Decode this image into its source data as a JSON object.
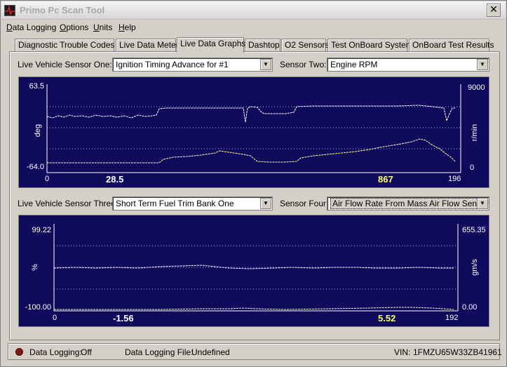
{
  "window": {
    "title": "Primo Pc  Scan Tool",
    "close_glyph": "✕"
  },
  "menu": [
    {
      "accel": "D",
      "rest": "ata Logging"
    },
    {
      "accel": "O",
      "rest": "ptions"
    },
    {
      "accel": "U",
      "rest": "nits"
    },
    {
      "accel": "H",
      "rest": "elp"
    }
  ],
  "tabs": [
    "Diagnostic Trouble Codes",
    "Live Data Meter",
    "Live Data Graphs",
    "Dashtop",
    "O2 Sensors",
    "Test OnBoard System",
    "OnBoard Test Results"
  ],
  "active_tab": "Live Data Graphs",
  "graph1": {
    "sensor_one_label": "Live Vehicle Sensor One:",
    "sensor_one_value": "Ignition Timing Advance for #1",
    "sensor_two_label": "Sensor Two:",
    "sensor_two_value": "Engine RPM",
    "left_max": "63.5",
    "left_min": "-64.0",
    "left_unit": "deg",
    "right_max": "9000",
    "right_min": "0",
    "right_unit": "r/min",
    "x_start": "0",
    "x_end": "196",
    "current_left": "28.5",
    "current_right": "867"
  },
  "graph2": {
    "sensor_three_label": "Live Vehicle Sensor Three:",
    "sensor_three_value": "Short Term Fuel Trim Bank One",
    "sensor_four_label": "Sensor Four:",
    "sensor_four_value": "Air Flow Rate From Mass Air Flow Sensor",
    "left_max": "99.22",
    "left_min": "-100.00",
    "left_unit": "%",
    "right_max": "655.35",
    "right_min": "0.00",
    "right_unit": "gm/s",
    "x_start": "0",
    "x_end": "192",
    "current_left": "-1.56",
    "current_right": "5.52"
  },
  "status": {
    "logging_label": "Data Logging:",
    "logging_value": "Off",
    "file_label": "Data Logging File:",
    "file_value": "Undefined",
    "vin_label": "VIN:",
    "vin_value": "1FMZU65W33ZB41961"
  },
  "colors": {
    "graph_bg": "#0f0a5c",
    "trace": "#ffffff",
    "trace_alt": "#ffff99",
    "value_left": "#ffffff",
    "value_right": "#ffff66",
    "led": "#7a1a10"
  },
  "icons": {
    "app": "oscilloscope-icon",
    "close": "close-icon",
    "dropdown": "chevron-down-icon",
    "logging": "led-indicator-icon"
  }
}
